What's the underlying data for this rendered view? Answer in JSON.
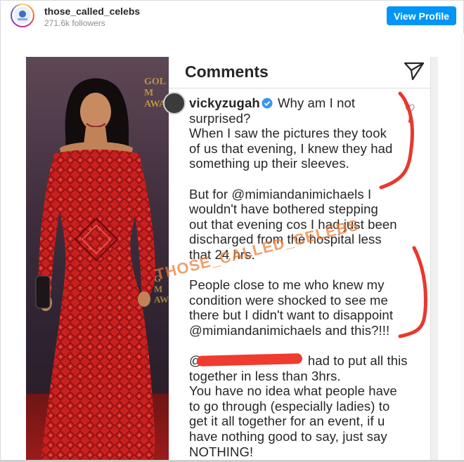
{
  "header": {
    "username": "those_called_celebs",
    "followers": "271.6k followers",
    "view_profile_label": "View Profile"
  },
  "post": {
    "photo": {
      "backdrop_text_top": "GOL\nM\nAWA",
      "backdrop_text_lower": "G\nM\nAW"
    },
    "comments_panel": {
      "title": "Comments",
      "comment": {
        "username": "vickyzugah",
        "text_line_1": "Why am I not\nsurprised?\nWhen I saw the pictures they took\nof us that evening, I knew they had\nsomething up their sleeves.\n\nBut for @mimiandanimichaels I\nwouldn't have bothered stepping\nout that evening cos I had just been\ndischarged from the hospital less\nthat 24 hrs.\n\nPeople close to me who knew my\ncondition were shocked to see me\nthere but I didn't want to disappoint\n@mimiandanimichaels and this?!!!\n\n@",
        "text_line_2": "had to put all this\ntogether in less than 3hrs.\nYou have no idea what people have\nto go through (especially ladies) to\nget it all together for an event, if u\nhave nothing good to say, just say\nNOTHING!"
      }
    },
    "watermark": "THOSE_CALLED_CELEBS"
  },
  "icons": {
    "send": "paper-plane-icon",
    "verified": "verified-badge-icon",
    "like": "heart-icon"
  },
  "colors": {
    "button_blue": "#0095f6",
    "dress_red": "#c8201e",
    "annotation_red": "#e8382e",
    "watermark_orange": "#ec7c34",
    "verified_blue": "#3897f0"
  }
}
